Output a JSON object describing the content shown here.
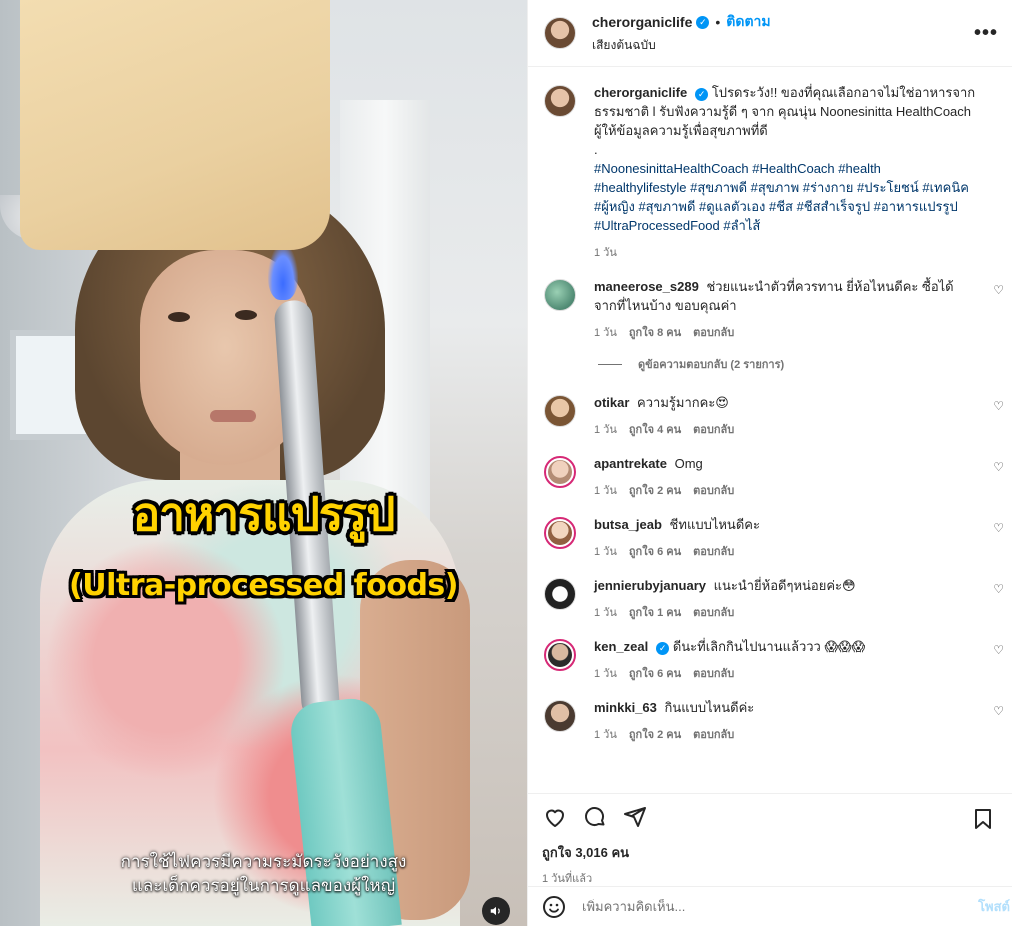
{
  "media": {
    "overlay_title_th": "อาหารแปรรูป",
    "overlay_title_en": "(Ultra-processed foods)",
    "subtitle_line1": "การใช้ไฟควรมีความระมัดระวังอย่างสูง",
    "subtitle_line2": "และเด็กควรอยู่ในการดูแลของผู้ใหญ่",
    "mute_icon": "speaker-icon"
  },
  "header": {
    "username": "cherorganiclife",
    "separator": "•",
    "follow_label": "ติดตาม",
    "audio_label": "เสียงต้นฉบับ",
    "more_label": "•••"
  },
  "caption": {
    "username": "cherorganiclife",
    "text": "โปรดระวัง!! ของที่คุณเลือกอาจไม่ใช่อาหารจากธรรมชาติ l รับฟังความรู้ดี ๆ จาก คุณนุ่น Noonesinitta HealthCoach ผู้ให้ข้อมูลความรู้เพื่อสุขภาพที่ดี",
    "dot": ".",
    "hashtags": "#NoonesinittaHealthCoach #HealthCoach #health #healthylifestyle #สุขภาพดี #สุขภาพ #ร่างกาย #ประโยชน์ #เทคนิค #ผู้หญิง #สุขภาพดี #ดูแลตัวเอง #ชีส #ชีสสำเร็จรูป #อาหารแปรรูป #UltraProcessedFood #ลำไส้",
    "age": "1 วัน"
  },
  "comments": [
    {
      "username": "maneerose_s289",
      "text": "ช่วยแนะนำตัวที่ควรทาน ยี่ห้อไหนดีคะ ซื้อได้จากที่ไหนบ้าง ขอบคุณค่า",
      "age": "1 วัน",
      "likes": "ถูกใจ 8 คน",
      "reply": "ตอบกลับ"
    },
    {
      "username": "otikar",
      "text": "ความรู้มากคะ😍",
      "age": "1 วัน",
      "likes": "ถูกใจ 4 คน",
      "reply": "ตอบกลับ"
    },
    {
      "username": "apantrekate",
      "text": "Omg",
      "age": "1 วัน",
      "likes": "ถูกใจ 2 คน",
      "reply": "ตอบกลับ"
    },
    {
      "username": "butsa_jeab",
      "text": "ชีทแบบไหนดีคะ",
      "age": "1 วัน",
      "likes": "ถูกใจ 6 คน",
      "reply": "ตอบกลับ"
    },
    {
      "username": "jennierubyjanuary",
      "text": "แนะนำยี่ห้อดีๆหน่อยค่ะ😳",
      "age": "1 วัน",
      "likes": "ถูกใจ 1 คน",
      "reply": "ตอบกลับ"
    },
    {
      "username": "ken_zeal",
      "text": "ดีนะที่เลิกกินไปนานแล้ววว 😱😱😱",
      "age": "1 วัน",
      "likes": "ถูกใจ 6 คน",
      "reply": "ตอบกลับ"
    },
    {
      "username": "minkki_63",
      "text": "กินแบบไหนดีค่ะ",
      "age": "1 วัน",
      "likes": "ถูกใจ 2 คน",
      "reply": "ตอบกลับ"
    }
  ],
  "view_replies_label": "ดูข้อความตอบกลับ (2 รายการ)",
  "actions": {
    "likes_count": "ถูกใจ 3,016 คน",
    "posted_time": "1 วันที่แล้ว"
  },
  "add_comment": {
    "placeholder": "เพิ่มความคิดเห็น...",
    "post_label": "โพสต์"
  },
  "colors": {
    "link_blue": "#0095f6",
    "hashtag": "#00376b",
    "overlay_yellow": "#ffd200"
  }
}
